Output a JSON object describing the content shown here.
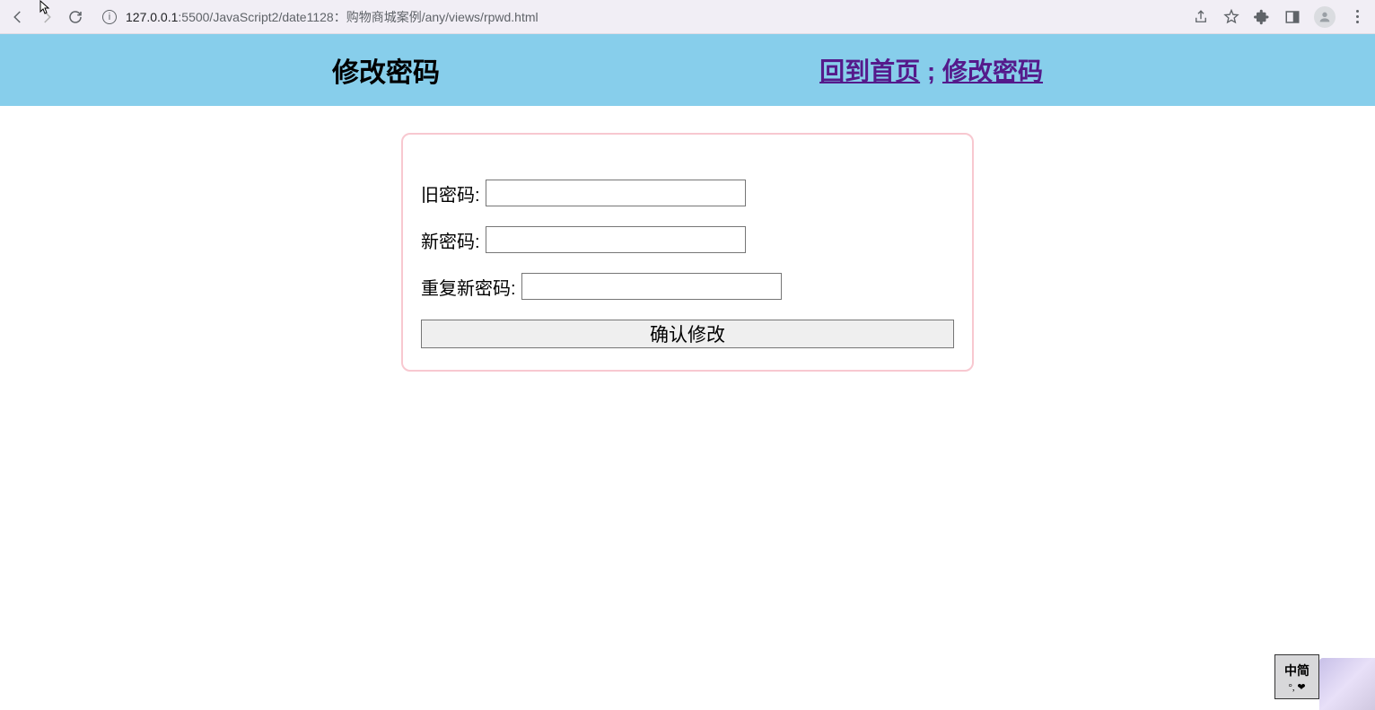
{
  "browser": {
    "url_host": "127.0.0.1",
    "url_port_path": ":5500/JavaScript2/date1128：购物商城案例/any/views/rpwd.html"
  },
  "header": {
    "title": "修改密码",
    "link_home": "回到首页",
    "separator": " ; ",
    "link_change_pwd": "修改密码"
  },
  "form": {
    "old_password_label": "旧密码:",
    "new_password_label": "新密码:",
    "repeat_password_label": "重复新密码:",
    "submit_label": "确认修改"
  },
  "ime": {
    "top": "中简",
    "bottom": "°, ❤"
  }
}
